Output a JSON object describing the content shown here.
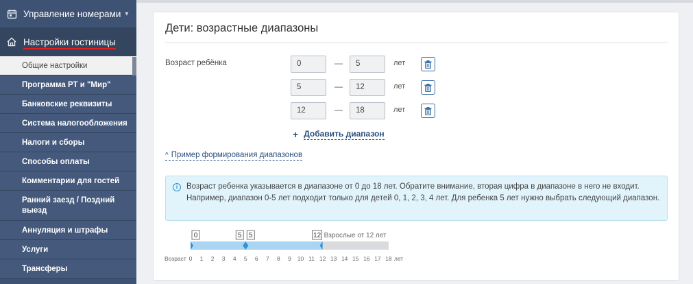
{
  "sidebar": {
    "header1": {
      "label": "Управление номерами"
    },
    "header2": {
      "label": "Настройки гостиницы"
    },
    "items": [
      {
        "label": "Общие настройки"
      },
      {
        "label": "Программа РТ и \"Мир\""
      },
      {
        "label": "Банковские реквизиты"
      },
      {
        "label": "Система налогообложения"
      },
      {
        "label": "Налоги и сборы"
      },
      {
        "label": "Способы оплаты"
      },
      {
        "label": "Комментарии для гостей"
      },
      {
        "label": "Ранний заезд / Поздний выезд"
      },
      {
        "label": "Аннуляция и штрафы"
      },
      {
        "label": "Услуги"
      },
      {
        "label": "Трансферы"
      }
    ]
  },
  "panel": {
    "title": "Дети: возрастные диапазоны",
    "age_label": "Возраст ребёнка",
    "unit": "лет",
    "dash": "—",
    "ranges": [
      {
        "from": "0",
        "to": "5"
      },
      {
        "from": "5",
        "to": "12"
      },
      {
        "from": "12",
        "to": "18"
      }
    ],
    "add_range": "Добавить диапазон",
    "example_toggle": "Пример формирования диапазонов",
    "info_text": "Возраст ребенка указывается в диапазоне от 0 до 18 лет. Обратите внимание, вторая цифра в диапазоне в него не входит. Например, диапазон 0-5 лет подходит только для детей 0, 1, 2, 3, 4 лет. Для ребенка 5 лет нужно выбрать следующий диапазон."
  },
  "timeline": {
    "axis_label": "Возраст",
    "axis_unit": "лет",
    "ticks": [
      "0",
      "1",
      "2",
      "3",
      "4",
      "5",
      "6",
      "7",
      "8",
      "9",
      "10",
      "11",
      "12",
      "13",
      "14",
      "15",
      "16",
      "17",
      "18"
    ],
    "markers": [
      "0",
      "5",
      "5",
      "12"
    ],
    "adult_label": "Взрослые от 12 лет",
    "child_range_end": 12,
    "max": 18,
    "colors": {
      "child": "#a9d5f3",
      "adult": "#d9dbde",
      "handle": "#2d8fd5"
    }
  }
}
